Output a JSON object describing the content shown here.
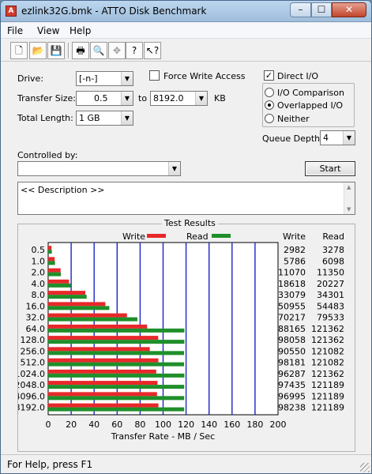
{
  "window": {
    "title": "ezlink32G.bmk - ATTO Disk Benchmark",
    "min": "–",
    "max": "☐",
    "close": "✕"
  },
  "menu": [
    {
      "label": "File"
    },
    {
      "label": "View"
    },
    {
      "label": "Help"
    }
  ],
  "toolbar": {
    "icons": [
      "new-icon",
      "open-icon",
      "save-icon",
      "print-icon",
      "print-preview-icon",
      "move-icon",
      "help-icon",
      "context-help-icon"
    ]
  },
  "controls": {
    "drive_label": "Drive:",
    "drive_value": "[-n-]",
    "transfer_size_label": "Transfer Size:",
    "transfer_from": "0.5",
    "to_label": "to",
    "transfer_to": "8192.0",
    "kb_label": "KB",
    "total_length_label": "Total Length:",
    "total_length_value": "1 GB",
    "force_write_label": "Force Write Access",
    "force_write_checked": false,
    "direct_io_label": "Direct I/O",
    "direct_io_checked": true,
    "io_comparison_label": "I/O Comparison",
    "overlapped_io_label": "Overlapped I/O",
    "neither_label": "Neither",
    "selected_io_mode": "Overlapped I/O",
    "queue_depth_label": "Queue Depth:",
    "queue_depth_value": "4",
    "controlled_by_label": "Controlled by:",
    "controlled_by_value": "",
    "start_label": "Start",
    "description": "<< Description >>"
  },
  "results": {
    "group_title": "Test Results"
  },
  "chart_data": {
    "type": "bar",
    "orientation": "horizontal",
    "categories": [
      "0.5",
      "1.0",
      "2.0",
      "4.0",
      "8.0",
      "16.0",
      "32.0",
      "64.0",
      "128.0",
      "256.0",
      "512.0",
      "1024.0",
      "2048.0",
      "4096.0",
      "8192.0"
    ],
    "series": [
      {
        "name": "Write",
        "color": "#e8282a",
        "values": [
          2982,
          5786,
          11070,
          18618,
          33079,
          50955,
          70217,
          88165,
          98058,
          90550,
          98181,
          96287,
          97435,
          96995,
          98238
        ]
      },
      {
        "name": "Read",
        "color": "#1f8f2a",
        "values": [
          3278,
          6098,
          11350,
          20227,
          34301,
          54483,
          79533,
          121362,
          121362,
          121082,
          121082,
          121362,
          121189,
          121189,
          121189
        ]
      }
    ],
    "x_ticks": [
      "0",
      "20",
      "40",
      "60",
      "80",
      "100",
      "120",
      "140",
      "160",
      "180",
      "200"
    ],
    "xlim": [
      0,
      200
    ],
    "xlabel": "Transfer Rate - MB / Sec",
    "value_units": "KB/sec",
    "col_headers": {
      "write": "Write",
      "read": "Read"
    },
    "legend_placement": "top",
    "grid_color": "#1b24c8",
    "grid": true
  },
  "status": {
    "text": "For Help, press F1"
  }
}
